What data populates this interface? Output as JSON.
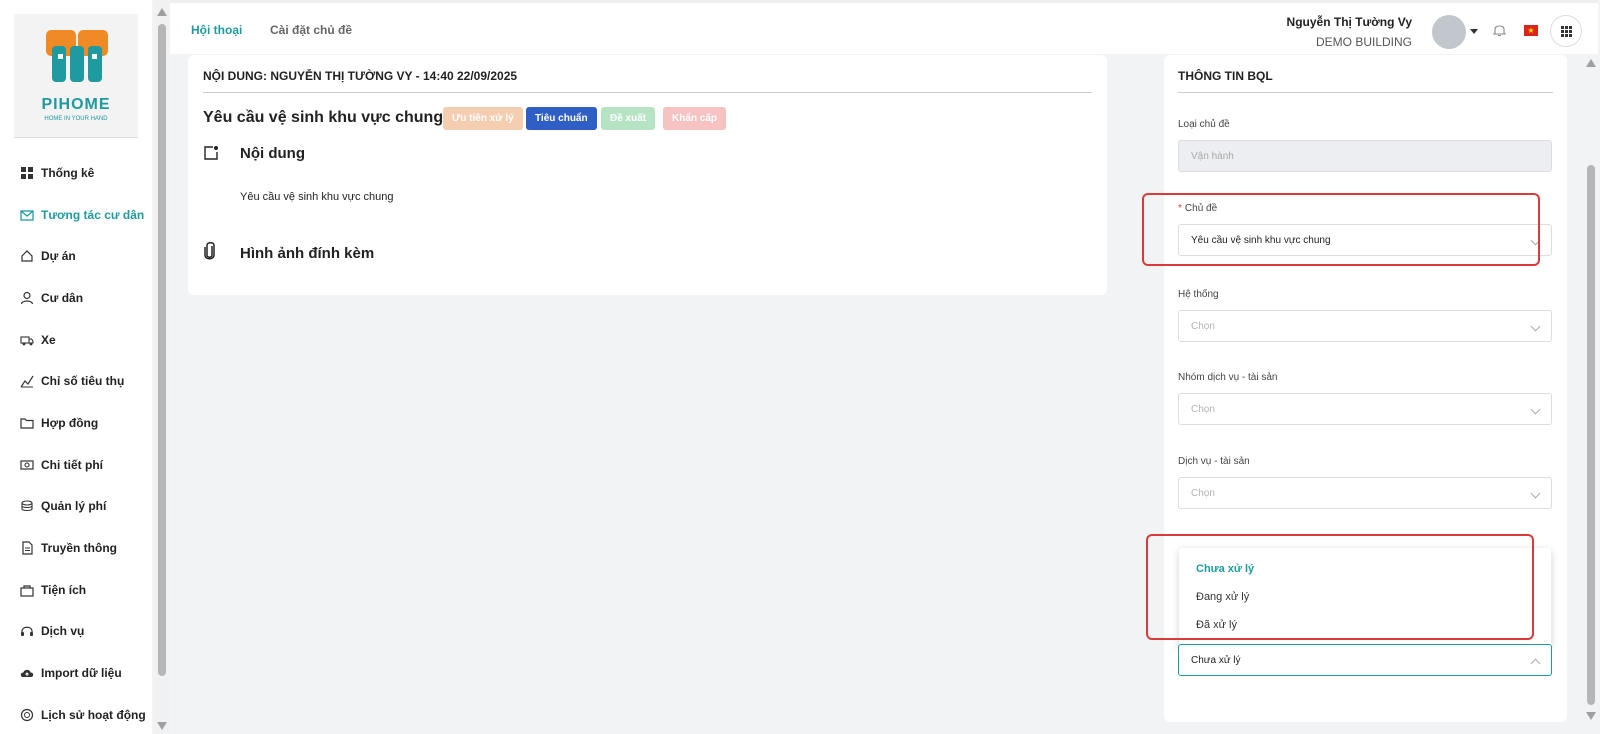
{
  "brand": {
    "name": "PIHOME",
    "tagline": "HOME IN YOUR HAND",
    "accent": "#1f9aa0",
    "logo_orange": "#f08a24"
  },
  "sidebar": {
    "items": [
      {
        "label": "Thống kê",
        "icon": "grid-icon"
      },
      {
        "label": "Tương tác cư dân",
        "icon": "mail-icon",
        "active": true
      },
      {
        "label": "Dự án",
        "icon": "home-icon"
      },
      {
        "label": "Cư dân",
        "icon": "user-icon"
      },
      {
        "label": "Xe",
        "icon": "truck-icon"
      },
      {
        "label": "Chỉ số tiêu thụ",
        "icon": "chart-icon"
      },
      {
        "label": "Hợp đồng",
        "icon": "folder-icon"
      },
      {
        "label": "Chi tiết phí",
        "icon": "money-icon"
      },
      {
        "label": "Quản lý phí",
        "icon": "coins-icon"
      },
      {
        "label": "Truyền thông",
        "icon": "document-icon"
      },
      {
        "label": "Tiện ích",
        "icon": "bag-icon"
      },
      {
        "label": "Dịch vụ",
        "icon": "headset-icon"
      },
      {
        "label": "Import dữ liệu",
        "icon": "cloud-upload-icon"
      },
      {
        "label": "Lịch sử hoạt động",
        "icon": "history-icon"
      }
    ]
  },
  "header": {
    "tabs": [
      {
        "label": "Hội thoại",
        "active": true
      },
      {
        "label": "Cài đặt chủ đề"
      }
    ],
    "user_name": "Nguyễn Thị Tường Vy",
    "building": "DEMO BUILDING"
  },
  "content": {
    "title": "NỘI DUNG: NGUYỄN THỊ TƯỜNG VY - 14:40 22/09/2025",
    "request_title": "Yêu cầu vệ sinh khu vực chung",
    "tags": [
      {
        "label": "Ưu tiên xử lý",
        "color": "#f5cdb0"
      },
      {
        "label": "Tiêu chuẩn",
        "color": "#2f5fc4"
      },
      {
        "label": "Đề xuất",
        "color": "#b5e3c4"
      },
      {
        "label": "Khẩn cấp",
        "color": "#f6c2c2"
      }
    ],
    "content_heading": "Nội dung",
    "content_text": "Yêu cầu vệ sinh khu vực chung",
    "attachments_heading": "Hình ảnh đính kèm"
  },
  "panel": {
    "title": "THÔNG TIN BQL",
    "topic_type_label": "Loại chủ đề",
    "topic_type_value": "Vận hành",
    "topic_label": "Chủ đề",
    "topic_value": "Yêu cầu vệ sinh khu vực chung",
    "system_label": "Hệ thống",
    "system_placeholder": "Chọn",
    "service_group_label": "Nhóm dịch vụ - tài sản",
    "service_group_placeholder": "Chọn",
    "service_label": "Dịch vụ - tài sản",
    "service_placeholder": "Chọn",
    "status_value": "Chưa xử lý",
    "status_options": [
      "Chưa xử lý",
      "Đang xử lý",
      "Đã xử lý"
    ],
    "highlight_color": "#d93a3a"
  }
}
